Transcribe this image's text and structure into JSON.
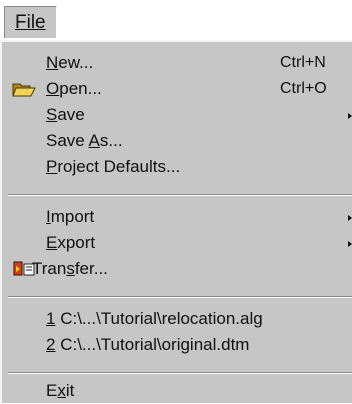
{
  "menu": {
    "title": "File",
    "items": {
      "new": {
        "pre": "",
        "key": "N",
        "post": "ew...",
        "shortcut": "Ctrl+N",
        "icon": ""
      },
      "open": {
        "pre": "",
        "key": "O",
        "post": "pen...",
        "shortcut": "Ctrl+O",
        "icon": "open-folder-icon"
      },
      "save": {
        "pre": "",
        "key": "S",
        "post": "ave",
        "submenu": true
      },
      "save_as": {
        "pre": "Save ",
        "key": "A",
        "post": "s..."
      },
      "project_defaults": {
        "pre": "",
        "key": "P",
        "post": "roject Defaults..."
      },
      "import": {
        "pre": "",
        "key": "I",
        "post": "mport",
        "submenu": true
      },
      "export": {
        "pre": "",
        "key": "E",
        "post": "xport",
        "submenu": true
      },
      "transfer": {
        "pre": "Tran",
        "key": "s",
        "post": "fer...",
        "icon": "transfer-icon"
      },
      "recent1": {
        "pre": "",
        "key": "1",
        "post": " C:\\...\\Tutorial\\relocation.alg"
      },
      "recent2": {
        "pre": "",
        "key": "2",
        "post": " C:\\...\\Tutorial\\original.dtm"
      },
      "exit": {
        "pre": "E",
        "key": "x",
        "post": "it"
      }
    }
  }
}
